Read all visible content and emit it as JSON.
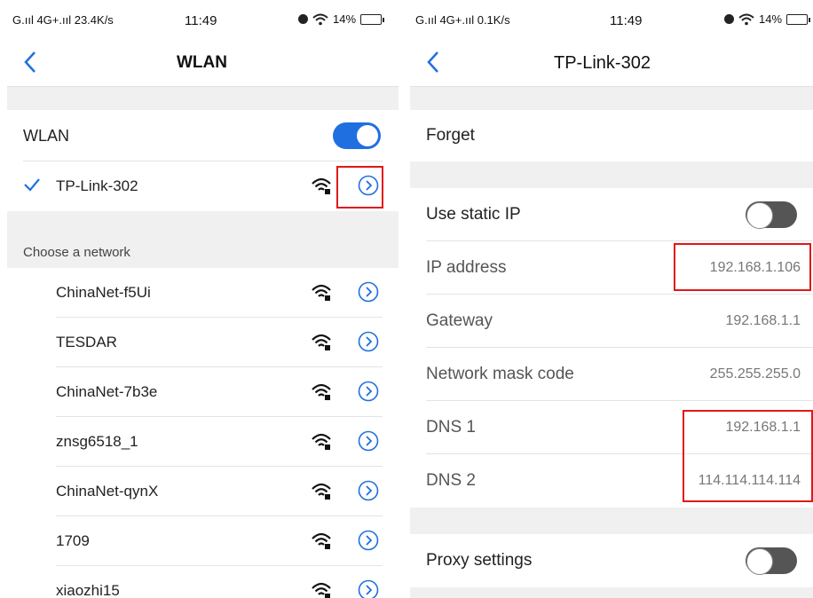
{
  "left": {
    "status": {
      "signal": "G.ııl 4G+.ııl 23.4K/s",
      "time": "11:49",
      "battery": "14%"
    },
    "nav": {
      "title": "WLAN"
    },
    "wlan_label": "WLAN",
    "connected_network": "TP-Link-302",
    "section_title": "Choose a network",
    "networks": [
      {
        "name": "ChinaNet-f5Ui"
      },
      {
        "name": "TESDAR"
      },
      {
        "name": "ChinaNet-7b3e"
      },
      {
        "name": "znsg6518_1"
      },
      {
        "name": "ChinaNet-qynX"
      },
      {
        "name": "1709"
      },
      {
        "name": "xiaozhi15"
      }
    ],
    "accent_color": "#1f6fe0"
  },
  "right": {
    "status": {
      "signal": "G.ııl 4G+.ııl 0.1K/s",
      "time": "11:49",
      "battery": "14%"
    },
    "nav": {
      "title": "TP-Link-302"
    },
    "forget_label": "Forget",
    "static_ip_label": "Use static IP",
    "fields": [
      {
        "key": "IP address",
        "value": "192.168.1.106"
      },
      {
        "key": "Gateway",
        "value": "192.168.1.1"
      },
      {
        "key": "Network mask code",
        "value": "255.255.255.0"
      },
      {
        "key": "DNS 1",
        "value": "192.168.1.1"
      },
      {
        "key": "DNS 2",
        "value": "114.114.114.114"
      }
    ],
    "proxy_label": "Proxy settings"
  },
  "highlight_color": "#e01818"
}
